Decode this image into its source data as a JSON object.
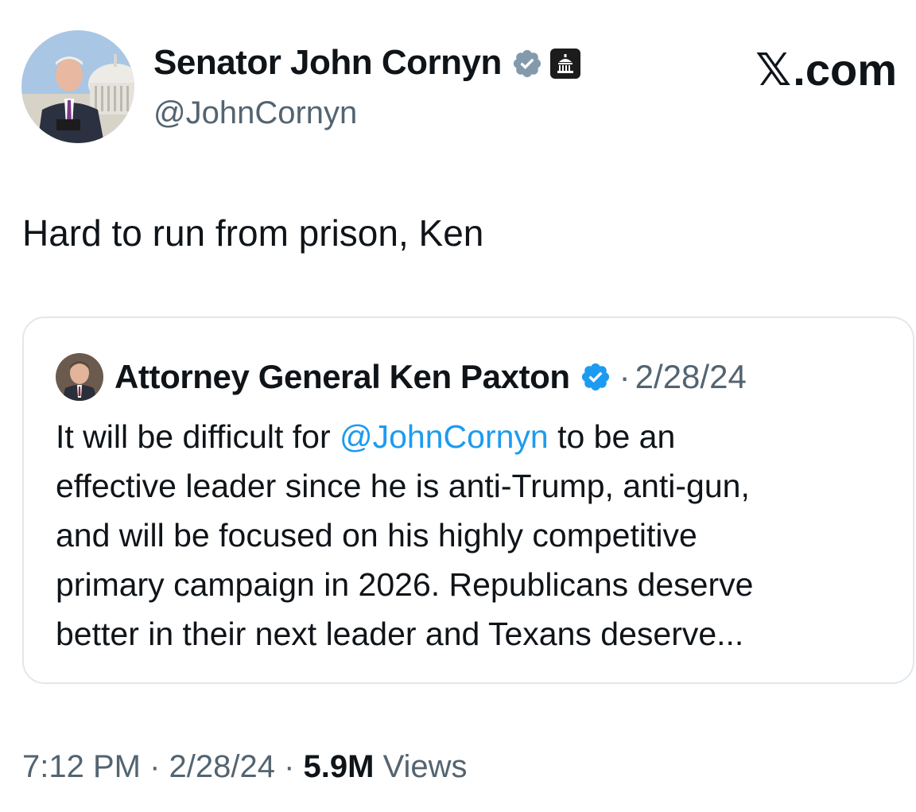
{
  "author": {
    "display_name": "Senator John Cornyn",
    "handle": "@JohnCornyn",
    "verified_badge": "grey-verified-check-icon",
    "affiliation_badge": "capitol-building-icon",
    "badge_color": "#829aab"
  },
  "brand": {
    "logo_letter": "𝕏",
    "logo_suffix": ".com"
  },
  "tweet": {
    "text": "Hard to run from prison, Ken"
  },
  "quote": {
    "author_name": "Attorney General Ken Paxton",
    "verified_badge": "blue-verified-check-icon",
    "badge_color": "#1d9bf0",
    "separator": "·",
    "date": "2/28/24",
    "lines": [
      {
        "before": "It will be difficult for ",
        "mention": "@JohnCornyn",
        "after": " to be an"
      },
      {
        "text": "effective leader since he is anti-Trump, anti-gun,"
      },
      {
        "text": "and will be focused on his highly competitive"
      },
      {
        "text": "primary campaign in 2026. Republicans deserve"
      },
      {
        "text": "better in their next leader and Texans deserve..."
      }
    ]
  },
  "meta": {
    "time": "7:12 PM",
    "sep1": " · ",
    "date": "2/28/24",
    "sep2": " · ",
    "views_count": "5.9M",
    "views_label": " Views"
  }
}
